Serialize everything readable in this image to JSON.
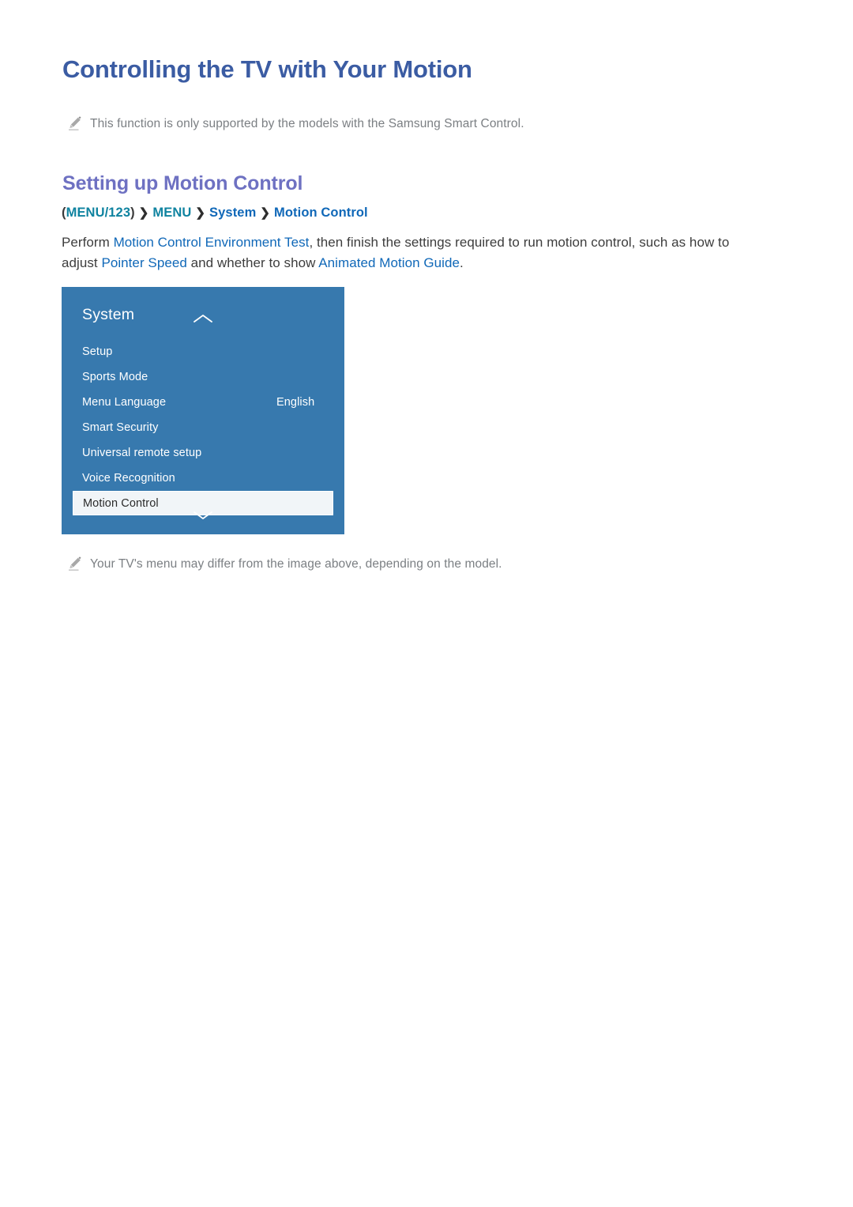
{
  "page": {
    "title": "Controlling the TV with Your Motion"
  },
  "notes": [
    {
      "icon": "pencil-icon",
      "text": "This function is only supported by the models with the Samsung Smart Control."
    },
    {
      "icon": "pencil-icon",
      "text": "Your TV's menu may differ from the image above, depending on the model."
    }
  ],
  "section": {
    "heading": "Setting up Motion Control",
    "breadcrumb": {
      "open_paren": "(",
      "close_paren": ")",
      "separator": "❯",
      "items": [
        {
          "label": "MENU/123",
          "style": "teal"
        },
        {
          "label": "MENU",
          "style": "teal"
        },
        {
          "label": "System",
          "style": "blue"
        },
        {
          "label": "Motion Control",
          "style": "blue"
        }
      ]
    },
    "body": {
      "part1": "Perform ",
      "link1": "Motion Control Environment Test",
      "part2": ", then finish the settings required to run motion control, such as how to adjust ",
      "link2": "Pointer Speed",
      "part3": " and whether to show ",
      "link3": "Animated Motion Guide",
      "part4": "."
    }
  },
  "tv_menu": {
    "title": "System",
    "scroll_up_icon": "chevron-up-icon",
    "scroll_down_icon": "chevron-down-icon",
    "items": [
      {
        "label": "Setup",
        "value": "",
        "selected": false
      },
      {
        "label": "Sports Mode",
        "value": "",
        "selected": false
      },
      {
        "label": "Menu Language",
        "value": "English",
        "selected": false
      },
      {
        "label": "Smart Security",
        "value": "",
        "selected": false
      },
      {
        "label": "Universal remote setup",
        "value": "",
        "selected": false
      },
      {
        "label": "Voice Recognition",
        "value": "",
        "selected": false
      },
      {
        "label": "Motion Control",
        "value": "",
        "selected": true
      }
    ]
  },
  "colors": {
    "title": "#3b5ca3",
    "heading": "#6e71c2",
    "link": "#1068b8",
    "teal": "#0f83a0",
    "panel_blue": "#3779ae",
    "selected_bg": "#f1f5f8",
    "note_text": "#7b7f83"
  }
}
